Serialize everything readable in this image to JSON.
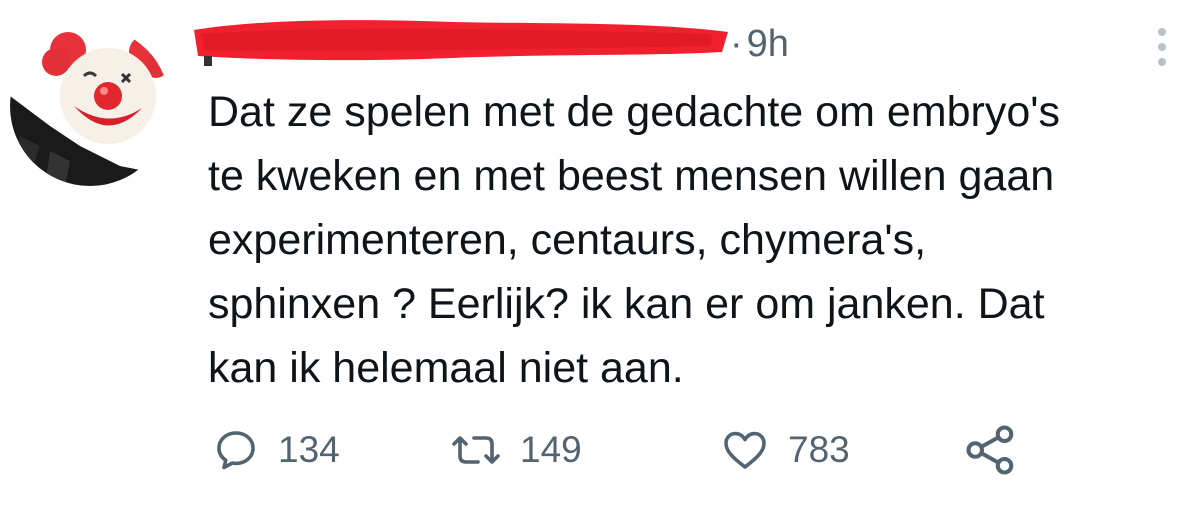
{
  "tweet": {
    "time": "9h",
    "text_lines": [
      "Dat ze spelen met de gedachte om embryo's",
      "te kweken en met beest mensen willen gaan",
      "experimenteren, centaurs, chymera's,",
      "sphinxen ? Eerlijk? ik kan er om janken. Dat",
      "kan ik helemaal niet aan."
    ],
    "author_redaction_color": "#f0202e"
  },
  "actions": {
    "reply_count": "134",
    "retweet_count": "149",
    "like_count": "783"
  },
  "icons": {
    "avatar": "clown-face-icon",
    "more": "more-vertical-icon",
    "reply": "reply-icon",
    "retweet": "retweet-icon",
    "like": "heart-icon",
    "share": "share-icon"
  },
  "colors": {
    "text": "#0f1419",
    "secondary": "#536471",
    "more_dots": "#b9c1c8"
  }
}
